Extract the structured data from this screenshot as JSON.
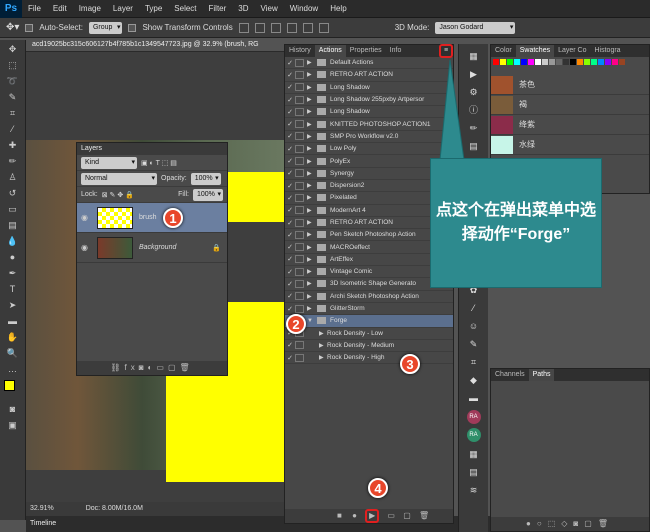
{
  "menubar": {
    "logo": "Ps",
    "items": [
      "File",
      "Edit",
      "Image",
      "Layer",
      "Type",
      "Select",
      "Filter",
      "3D",
      "View",
      "Window",
      "Help"
    ]
  },
  "options": {
    "auto_select": "Auto-Select:",
    "group": "Group",
    "show_transform": "Show Transform Controls",
    "mode3d": "3D Mode:",
    "workspace": "Jason Godard"
  },
  "document": {
    "tab_title": "acd19025bc315c606127b4f785b1c1349547723.jpg @ 32.9% (brush, RG",
    "zoom": "32.91%",
    "doc_info": "Doc: 8.00M/16.0M",
    "timeline": "Timeline"
  },
  "layers": {
    "title": "Layers",
    "kind": "Kind",
    "blend": "Normal",
    "opacity_label": "Opacity:",
    "opacity": "100%",
    "lock_label": "Lock:",
    "fill_label": "Fill:",
    "fill": "100%",
    "items": [
      {
        "name": "brush"
      },
      {
        "name": "Background"
      }
    ]
  },
  "actions": {
    "tabs": [
      "History",
      "Actions",
      "Properties",
      "Info"
    ],
    "items": [
      "Default Actions",
      "RETRO ART ACTION",
      "Long Shadow",
      "Long Shadow 255pxby Artpersor",
      "Long Shadow",
      "KNITTED PHOTOSHOP ACTION1",
      "SMP Pro Workflow v2.0",
      "Low Poly",
      "PolyEx",
      "Synergy",
      "Dispersion2",
      "Pixelated",
      "ModernArt 4",
      "RETRO ART ACTION",
      "Pen Sketch Photoshop Action",
      "MACROeffect",
      "ArtEffex",
      "Vintage Comic",
      "3D Isometric Shape Generato",
      "Archi Sketch Photoshop Action",
      "GlitterStorm",
      "Forge",
      "Rock Density - Low",
      "Rock Density - Medium",
      "Rock Density - High"
    ]
  },
  "swatches": {
    "tabs": [
      "Color",
      "Swatches",
      "Layer Co",
      "Histogra"
    ],
    "named": [
      {
        "name": "茶色",
        "color": "#a0522d"
      },
      {
        "name": "褐",
        "color": "#7a5c3a"
      },
      {
        "name": "绛紫",
        "color": "#8b2c4a"
      },
      {
        "name": "水绿",
        "color": "#c7f5e8"
      }
    ]
  },
  "channels": {
    "tabs": [
      "Channels",
      "Paths"
    ]
  },
  "annotation": {
    "callout": "点这个在弹出菜单中选择动作“Forge”",
    "badges": [
      "1",
      "2",
      "3",
      "4"
    ]
  },
  "colors": {
    "badge": "#e8462a",
    "callout": "#2d8a8e",
    "selected_action": "#5b6f8e",
    "selected_layer": "#6b7fa0",
    "brush_fill": "#ffff00"
  }
}
